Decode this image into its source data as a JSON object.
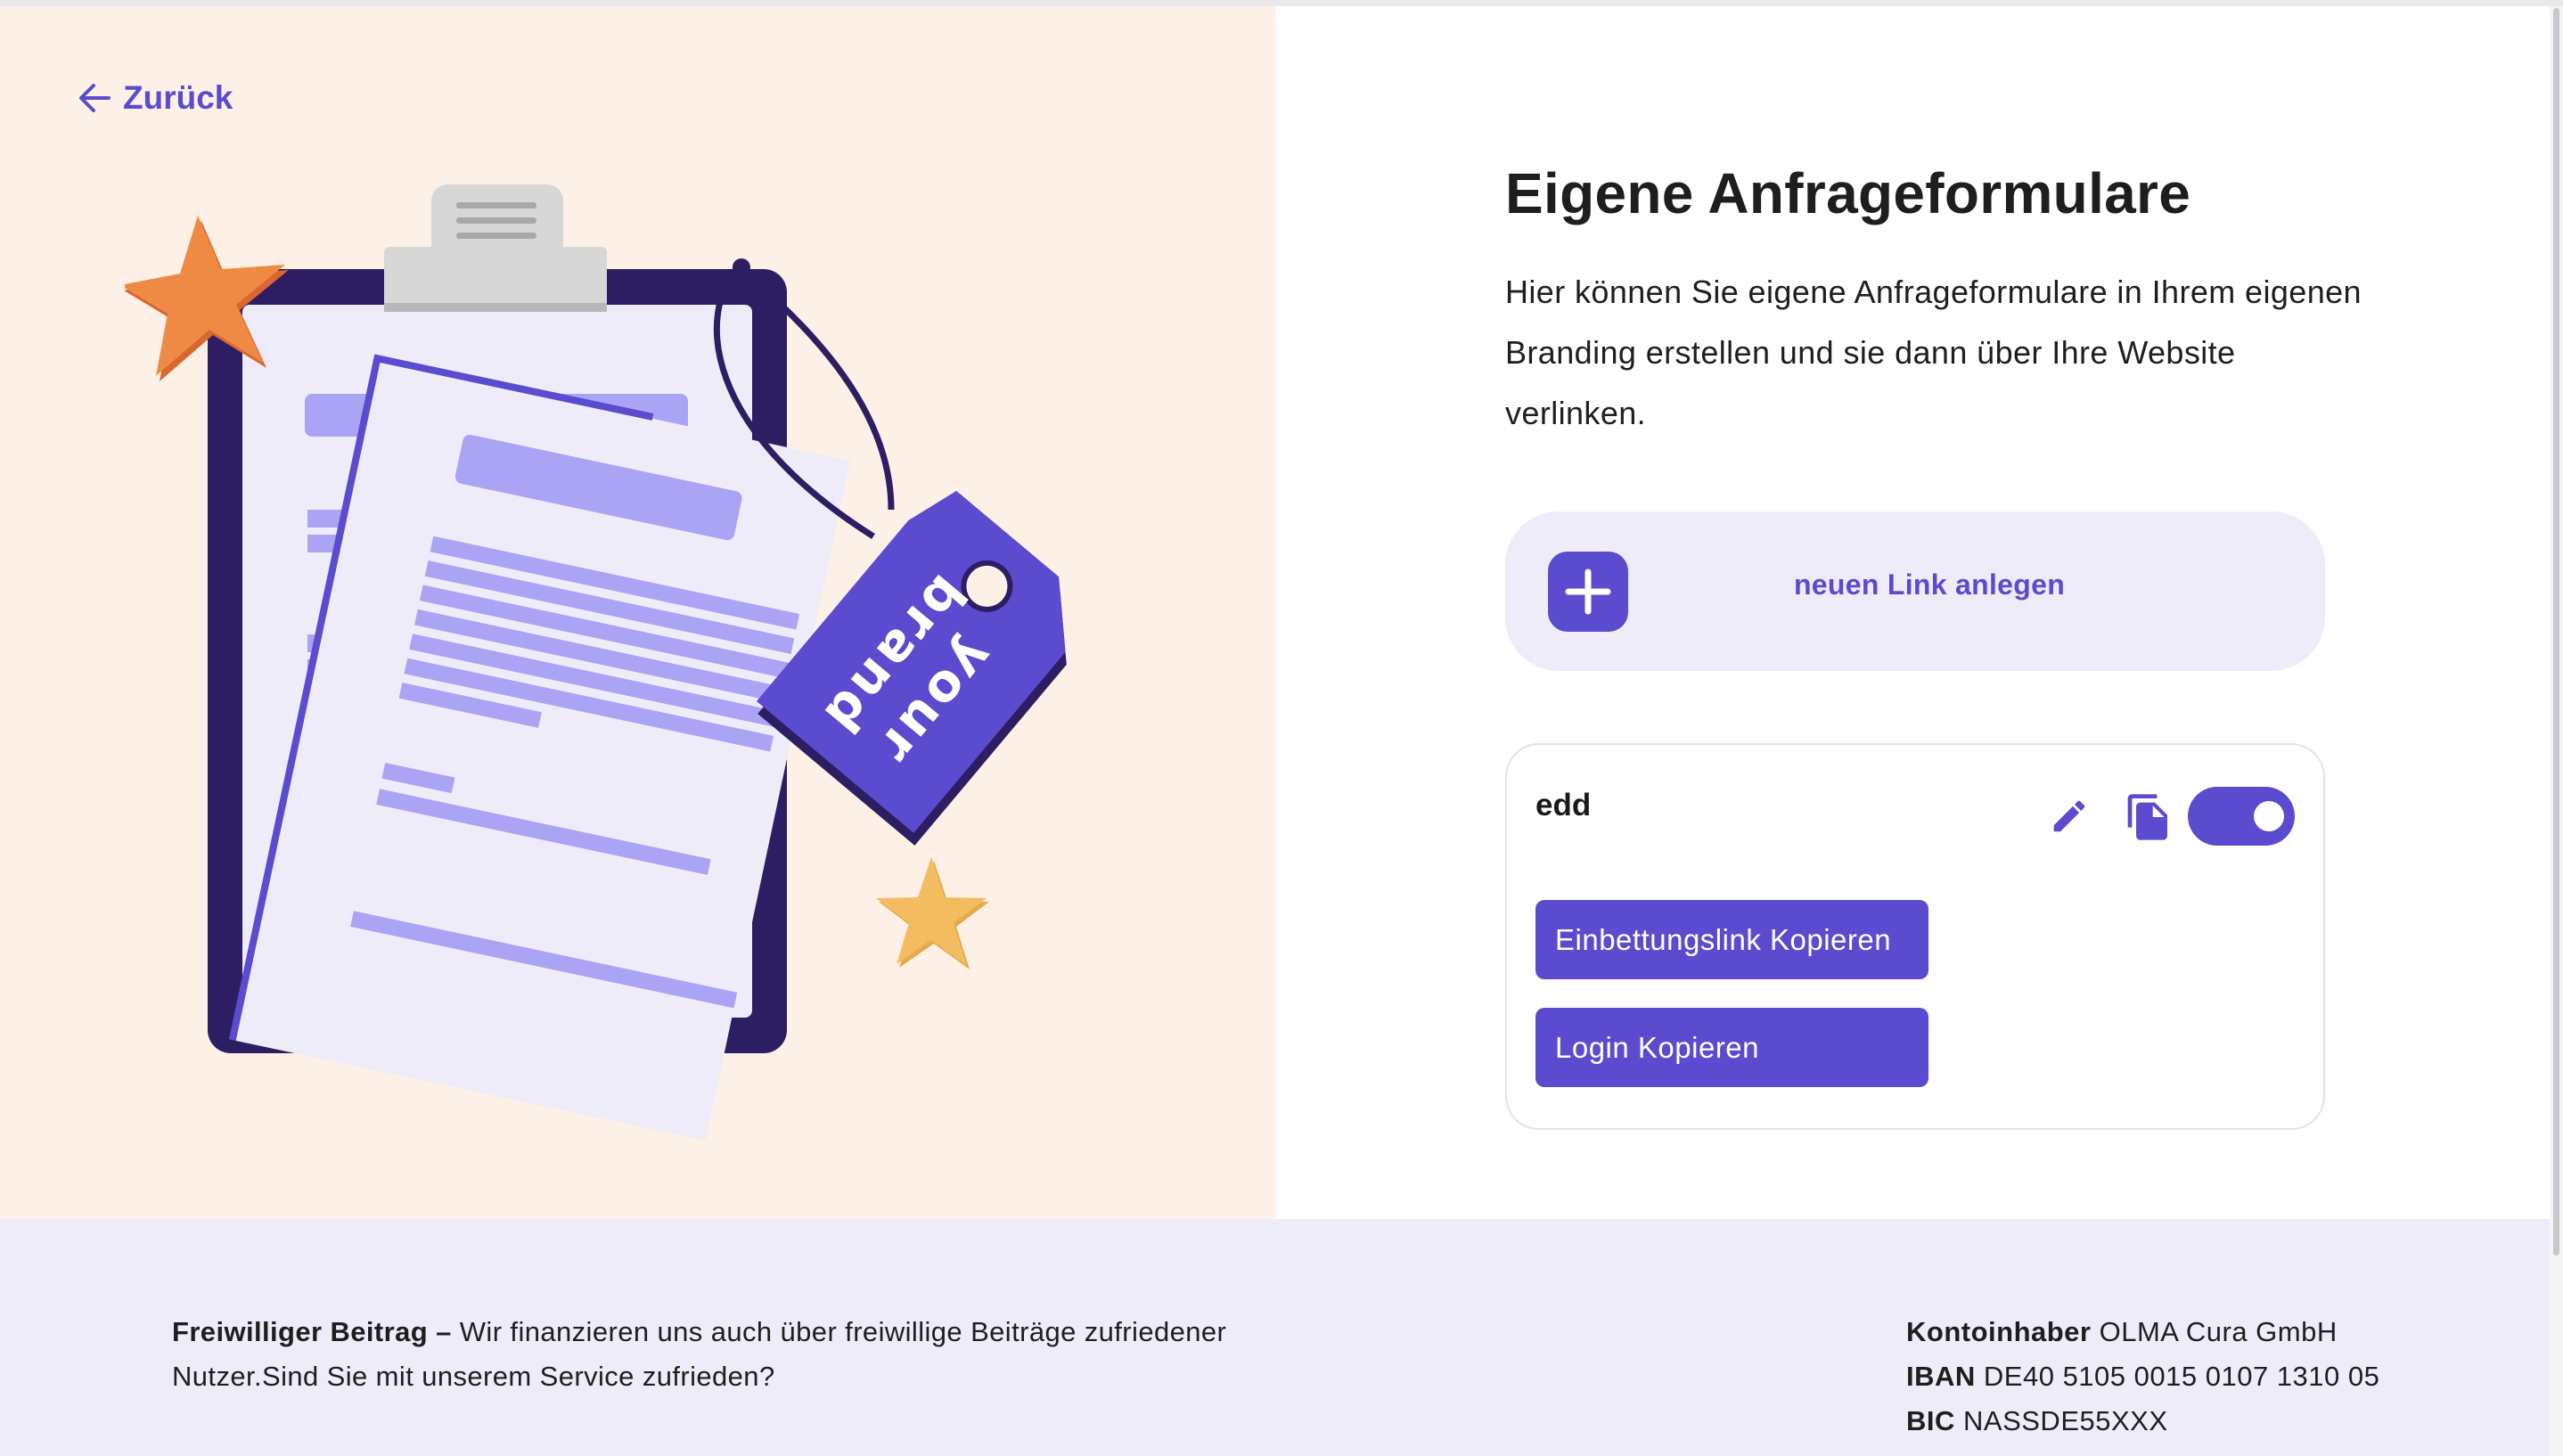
{
  "nav": {
    "back_label": "Zurück"
  },
  "main": {
    "title": "Eigene Anfrageformulare",
    "description": "Hier können Sie eigene Anfrageformulare in Ihrem eigenen Branding erstellen und sie dann über Ihre Website verlinken."
  },
  "new_link": {
    "label": "neuen Link anlegen",
    "icon": "plus-icon"
  },
  "link_card": {
    "name": "edd",
    "edit_icon": "pencil-icon",
    "copy_icon": "copy-icon",
    "enabled": true,
    "embed_button": "Einbettungslink Kopieren",
    "login_button": "Login Kopieren"
  },
  "illustration": {
    "tag_text_1": "your",
    "tag_text_2": "brand"
  },
  "footer": {
    "donation_title": "Freiwilliger Beitrag –",
    "donation_text": "Wir finanzieren uns auch über freiwillige Beiträge zufriedener Nutzer.Sind Sie mit unserem Service zufrieden?",
    "account_holder_label": "Kontoinhaber",
    "account_holder_value": "OLMA Cura GmbH",
    "iban_label": "IBAN",
    "iban_value": "DE40 5105 0015 0107 1310 05",
    "bic_label": "BIC",
    "bic_value": "NASSDE55XXX"
  },
  "colors": {
    "accent": "#5b4bcf",
    "left_background": "#fdf1e7",
    "footer_background": "#eeecf9"
  }
}
